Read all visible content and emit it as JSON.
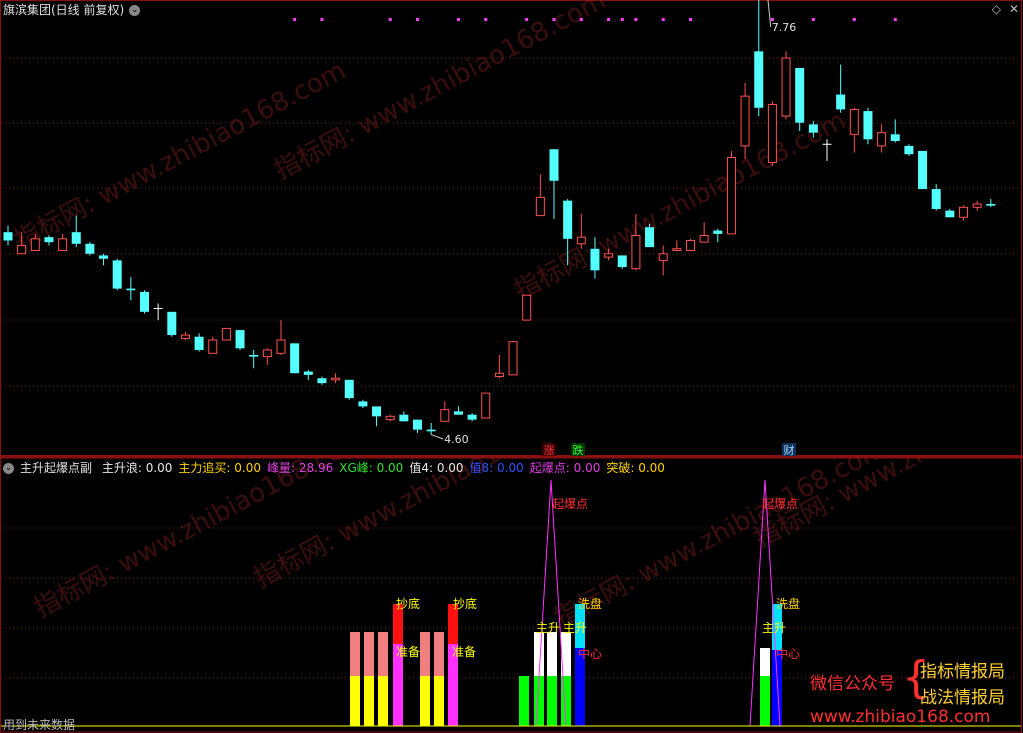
{
  "main_chart": {
    "title": "旗滨集团(日线 前复权)",
    "high_label": "7.76",
    "low_label": "4.60",
    "markers": [
      {
        "label": "涨",
        "color": "#ff3030",
        "bg": "#3a0000"
      },
      {
        "label": "跌",
        "color": "#30ff30",
        "bg": "#003a00"
      },
      {
        "label": "财",
        "color": "#a0d8ff",
        "bg": "#10305a"
      }
    ],
    "icons": [
      "diamond-icon",
      "close-icon"
    ]
  },
  "indicator": {
    "title": "主升起爆点副",
    "values": [
      {
        "label": "主升浪:",
        "value": "0.00",
        "color": "#e8e8e8"
      },
      {
        "label": "主力追买:",
        "value": "0.00",
        "color": "#ffd000"
      },
      {
        "label": "峰量:",
        "value": "28.96",
        "color": "#e040e0"
      },
      {
        "label": "XG峰:",
        "value": "0.00",
        "color": "#30e030"
      },
      {
        "label": "值4:",
        "value": "0.00",
        "color": "#e8e8e8"
      },
      {
        "label": "值8:",
        "value": "0.00",
        "color": "#3050ff"
      },
      {
        "label": "起爆点:",
        "value": "0.00",
        "color": "#e040e0"
      },
      {
        "label": "突破:",
        "value": "0.00",
        "color": "#ffd000"
      }
    ],
    "labels": {
      "explode": "起爆点",
      "bottom": "抄底",
      "prepare": "准备",
      "main_up": "主升",
      "wash": "洗盘",
      "core": "中心"
    },
    "footer": "用到未来数据"
  },
  "promo": {
    "wechat": "微信公众号",
    "name1": "指标情报局",
    "name2": "战法情报局",
    "url": "www.zhibiao168.com",
    "watermark": "指标网: www.zhibiao168.com"
  },
  "candles": [
    {
      "o": 5.82,
      "c": 5.77,
      "h": 5.86,
      "l": 5.74
    },
    {
      "o": 5.69,
      "c": 5.74,
      "h": 5.82,
      "l": 5.69
    },
    {
      "o": 5.71,
      "c": 5.78,
      "h": 5.81,
      "l": 5.71
    },
    {
      "o": 5.79,
      "c": 5.76,
      "h": 5.8,
      "l": 5.74
    },
    {
      "o": 5.71,
      "c": 5.78,
      "h": 5.81,
      "l": 5.71
    },
    {
      "o": 5.82,
      "c": 5.75,
      "h": 5.92,
      "l": 5.73
    },
    {
      "o": 5.75,
      "c": 5.69,
      "h": 5.76,
      "l": 5.68
    },
    {
      "o": 5.68,
      "c": 5.66,
      "h": 5.69,
      "l": 5.62
    },
    {
      "o": 5.65,
      "c": 5.48,
      "h": 5.66,
      "l": 5.47
    },
    {
      "o": 5.48,
      "c": 5.47,
      "h": 5.55,
      "l": 5.41
    },
    {
      "o": 5.46,
      "c": 5.34,
      "h": 5.47,
      "l": 5.33
    },
    {
      "o": 5.36,
      "c": 5.36,
      "h": 5.39,
      "l": 5.29
    },
    {
      "o": 5.34,
      "c": 5.2,
      "h": 5.34,
      "l": 5.19
    },
    {
      "o": 5.18,
      "c": 5.2,
      "h": 5.22,
      "l": 5.17
    },
    {
      "o": 5.19,
      "c": 5.11,
      "h": 5.21,
      "l": 5.1
    },
    {
      "o": 5.09,
      "c": 5.17,
      "h": 5.19,
      "l": 5.09
    },
    {
      "o": 5.17,
      "c": 5.24,
      "h": 5.24,
      "l": 5.17
    },
    {
      "o": 5.23,
      "c": 5.12,
      "h": 5.23,
      "l": 5.11
    },
    {
      "o": 5.08,
      "c": 5.07,
      "h": 5.11,
      "l": 5.0
    },
    {
      "o": 5.07,
      "c": 5.11,
      "h": 5.12,
      "l": 5.02
    },
    {
      "o": 5.09,
      "c": 5.17,
      "h": 5.29,
      "l": 5.08
    },
    {
      "o": 5.15,
      "c": 4.97,
      "h": 5.15,
      "l": 4.97
    },
    {
      "o": 4.98,
      "c": 4.96,
      "h": 4.99,
      "l": 4.93
    },
    {
      "o": 4.94,
      "c": 4.91,
      "h": 4.95,
      "l": 4.9
    },
    {
      "o": 4.93,
      "c": 4.94,
      "h": 4.97,
      "l": 4.91
    },
    {
      "o": 4.93,
      "c": 4.82,
      "h": 4.93,
      "l": 4.81
    },
    {
      "o": 4.8,
      "c": 4.77,
      "h": 4.81,
      "l": 4.76
    },
    {
      "o": 4.77,
      "c": 4.71,
      "h": 4.77,
      "l": 4.65
    },
    {
      "o": 4.69,
      "c": 4.71,
      "h": 4.72,
      "l": 4.68
    },
    {
      "o": 4.72,
      "c": 4.68,
      "h": 4.74,
      "l": 4.68
    },
    {
      "o": 4.69,
      "c": 4.63,
      "h": 4.69,
      "l": 4.61
    },
    {
      "o": 4.63,
      "c": 4.62,
      "h": 4.67,
      "l": 4.6
    },
    {
      "o": 4.68,
      "c": 4.75,
      "h": 4.8,
      "l": 4.68
    },
    {
      "o": 4.74,
      "c": 4.72,
      "h": 4.77,
      "l": 4.72
    },
    {
      "o": 4.72,
      "c": 4.69,
      "h": 4.73,
      "l": 4.68
    },
    {
      "o": 4.7,
      "c": 4.85,
      "h": 4.85,
      "l": 4.7
    },
    {
      "o": 4.95,
      "c": 4.97,
      "h": 5.08,
      "l": 4.94
    },
    {
      "o": 4.96,
      "c": 5.16,
      "h": 5.16,
      "l": 4.96
    },
    {
      "o": 5.29,
      "c": 5.44,
      "h": 5.44,
      "l": 5.29
    },
    {
      "o": 5.92,
      "c": 6.03,
      "h": 6.17,
      "l": 5.92
    },
    {
      "o": 6.32,
      "c": 6.13,
      "h": 6.32,
      "l": 5.9
    },
    {
      "o": 6.01,
      "c": 5.78,
      "h": 6.02,
      "l": 5.62
    },
    {
      "o": 5.75,
      "c": 5.79,
      "h": 5.93,
      "l": 5.72
    },
    {
      "o": 5.72,
      "c": 5.59,
      "h": 5.79,
      "l": 5.54
    },
    {
      "o": 5.67,
      "c": 5.69,
      "h": 5.72,
      "l": 5.65
    },
    {
      "o": 5.68,
      "c": 5.61,
      "h": 5.68,
      "l": 5.6
    },
    {
      "o": 5.6,
      "c": 5.8,
      "h": 5.93,
      "l": 5.59
    },
    {
      "o": 5.85,
      "c": 5.73,
      "h": 5.87,
      "l": 5.73
    },
    {
      "o": 5.65,
      "c": 5.69,
      "h": 5.74,
      "l": 5.56
    },
    {
      "o": 5.71,
      "c": 5.72,
      "h": 5.77,
      "l": 5.71
    },
    {
      "o": 5.71,
      "c": 5.77,
      "h": 5.78,
      "l": 5.71
    },
    {
      "o": 5.76,
      "c": 5.8,
      "h": 5.88,
      "l": 5.76
    },
    {
      "o": 5.83,
      "c": 5.81,
      "h": 5.84,
      "l": 5.76
    },
    {
      "o": 5.81,
      "c": 6.27,
      "h": 6.31,
      "l": 5.81
    },
    {
      "o": 6.34,
      "c": 6.64,
      "h": 6.72,
      "l": 6.26
    },
    {
      "o": 6.91,
      "c": 6.57,
      "h": 7.76,
      "l": 6.52
    },
    {
      "o": 6.24,
      "c": 6.59,
      "h": 6.61,
      "l": 6.22
    },
    {
      "o": 6.52,
      "c": 6.87,
      "h": 6.91,
      "l": 6.5
    },
    {
      "o": 6.81,
      "c": 6.48,
      "h": 6.81,
      "l": 6.43
    },
    {
      "o": 6.47,
      "c": 6.42,
      "h": 6.49,
      "l": 6.39
    },
    {
      "o": 6.35,
      "c": 6.35,
      "h": 6.38,
      "l": 6.25
    },
    {
      "o": 6.65,
      "c": 6.56,
      "h": 6.83,
      "l": 6.54
    },
    {
      "o": 6.41,
      "c": 6.56,
      "h": 6.57,
      "l": 6.3
    },
    {
      "o": 6.55,
      "c": 6.38,
      "h": 6.57,
      "l": 6.35
    },
    {
      "o": 6.34,
      "c": 6.42,
      "h": 6.47,
      "l": 6.3
    },
    {
      "o": 6.41,
      "c": 6.37,
      "h": 6.5,
      "l": 6.36
    },
    {
      "o": 6.34,
      "c": 6.29,
      "h": 6.35,
      "l": 6.28
    },
    {
      "o": 6.31,
      "c": 6.08,
      "h": 6.31,
      "l": 6.08
    },
    {
      "o": 6.08,
      "c": 5.96,
      "h": 6.11,
      "l": 5.95
    },
    {
      "o": 5.95,
      "c": 5.91,
      "h": 5.96,
      "l": 5.91
    },
    {
      "o": 5.91,
      "c": 5.97,
      "h": 5.98,
      "l": 5.89
    },
    {
      "o": 5.97,
      "c": 5.99,
      "h": 6.01,
      "l": 5.95
    },
    {
      "o": 5.99,
      "c": 5.98,
      "h": 6.02,
      "l": 5.97
    }
  ]
}
